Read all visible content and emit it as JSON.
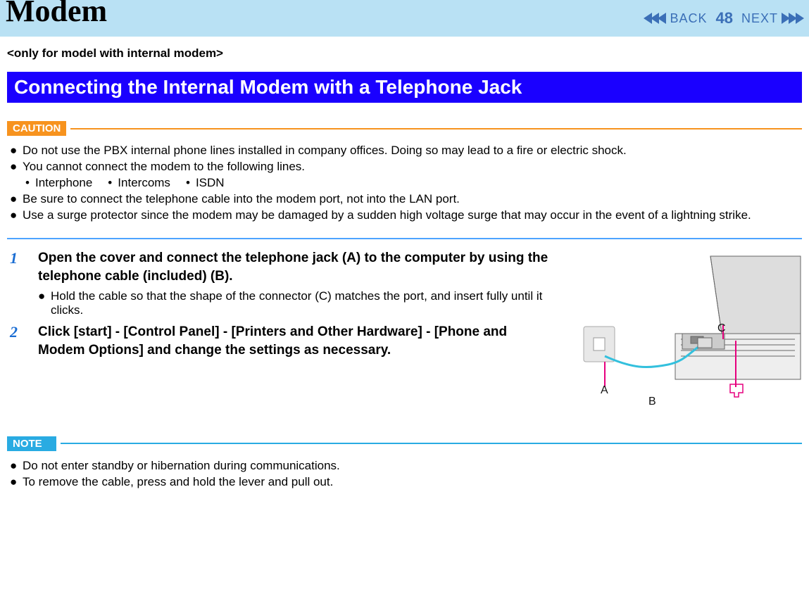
{
  "header": {
    "title": "Modem",
    "nav_back": "BACK",
    "nav_next": "NEXT",
    "page_number": "48"
  },
  "subheader": "<only for model with internal modem>",
  "blue_band": "Connecting the Internal Modem with a Telephone Jack",
  "caution": {
    "label": "CAUTION",
    "bullets": [
      "Do not use the PBX internal phone lines installed in company offices. Doing so may lead to a fire or electric shock.",
      "You cannot connect the modem to the following lines.",
      "Be sure to connect the telephone cable into the modem port, not into the LAN port.",
      "Use a surge protector since the modem may be damaged by a sudden high voltage surge that may occur in the event of a lightning strike."
    ],
    "sub_bullets": [
      "Interphone",
      "Intercoms",
      "ISDN"
    ]
  },
  "steps": [
    {
      "num": "1",
      "title": "Open the cover and connect the telephone jack (A) to the computer by using the telephone cable (included) (B).",
      "sub": "Hold the cable so that the shape of the connector (C) matches the port, and insert fully until it clicks."
    },
    {
      "num": "2",
      "title": "Click [start] - [Control Panel] - [Printers and Other Hardware] - [Phone and Modem Options] and change the settings as necessary."
    }
  ],
  "illustration": {
    "labels": {
      "A": "A",
      "B": "B",
      "C": "C"
    }
  },
  "note": {
    "label": "NOTE",
    "bullets": [
      "Do not enter standby or hibernation during communications.",
      "To remove the cable, press and hold the lever and pull out."
    ]
  }
}
